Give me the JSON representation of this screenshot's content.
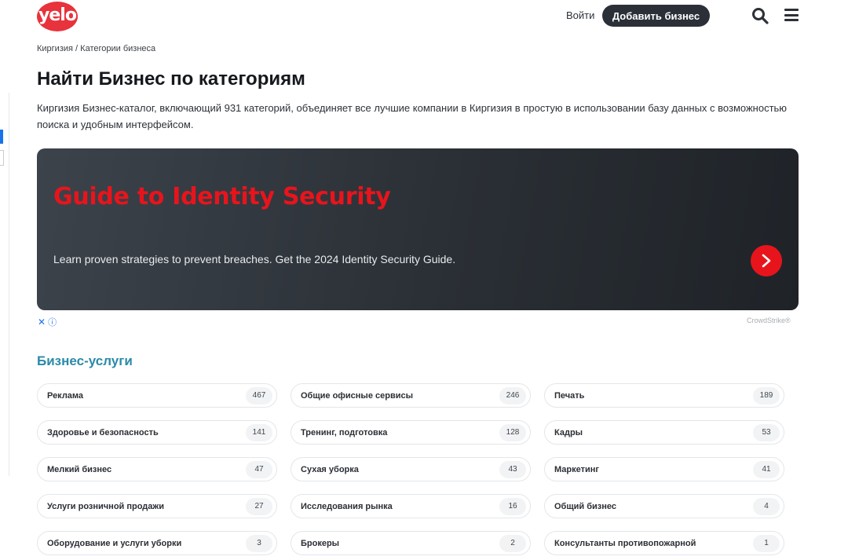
{
  "header": {
    "logo_text": "yelo",
    "login_label": "Войти",
    "add_business_label": "Добавить бизнес"
  },
  "breadcrumb": {
    "home": "Киргизия",
    "separator": "/",
    "current": "Категории бизнеса"
  },
  "page": {
    "title": "Найти Бизнес по категориям",
    "description": "Киргизия Бизнес-каталог, включающий 931 категорий, объединяет все лучшие компании в Киргизия в простую в использовании базу данных с возможностью поиска и удобным интерфейсом."
  },
  "ad": {
    "title": "Guide to Identity Security",
    "text": "Learn proven strategies to prevent breaches. Get the 2024 Identity Security Guide.",
    "brand": "CrowdStrike®",
    "close_label": "✕",
    "info_label": "ⓘ",
    "title_color": "#e8141c"
  },
  "section": {
    "title": "Бизнес-услуги",
    "categories": [
      {
        "label": "Реклама",
        "count": "467"
      },
      {
        "label": "Общие офисные сервисы",
        "count": "246"
      },
      {
        "label": "Печать",
        "count": "189"
      },
      {
        "label": "Здоровье и безопасность",
        "count": "141"
      },
      {
        "label": "Тренинг, подготовка",
        "count": "128"
      },
      {
        "label": "Кадры",
        "count": "53"
      },
      {
        "label": "Мелкий бизнес",
        "count": "47"
      },
      {
        "label": "Сухая уборка",
        "count": "43"
      },
      {
        "label": "Маркетинг",
        "count": "41"
      },
      {
        "label": "Услуги розничной продажи",
        "count": "27"
      },
      {
        "label": "Исследования рынка",
        "count": "16"
      },
      {
        "label": "Общий бизнес",
        "count": "4"
      },
      {
        "label": "Оборудование и услуги уборки",
        "count": "3"
      },
      {
        "label": "Брокеры",
        "count": "2"
      },
      {
        "label": "Консультанты противопожарной",
        "count": "1"
      }
    ]
  },
  "colors": {
    "brand": "#e8323c",
    "section_title": "#2a8aa8",
    "dark_button": "#2b3038"
  }
}
